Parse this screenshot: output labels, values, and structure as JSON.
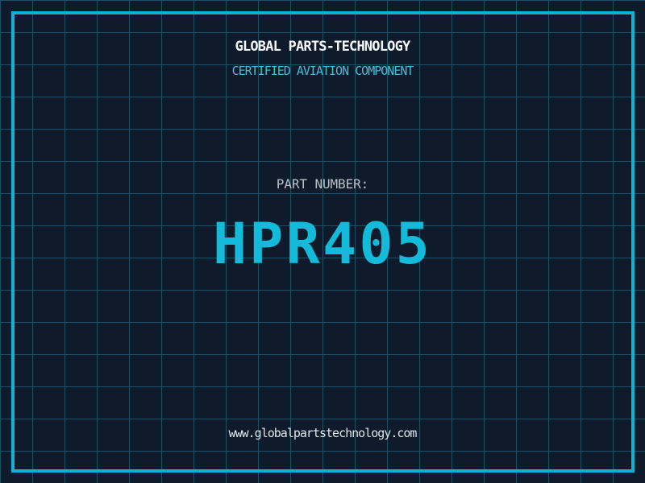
{
  "screen": {
    "company_title": "GLOBAL PARTS-TECHNOLOGY",
    "subtitle": "CERTIFIED AVIATION COMPONENT",
    "part_number_label": "PART NUMBER:",
    "part_number": "HPR405",
    "website": "www.globalpartstechnology.com"
  },
  "colors": {
    "background": "#0f1a2a",
    "grid_line": "#1d5064",
    "frame_border": "#0fb1d5",
    "title_text": "#f5f8fa",
    "subtitle_text": "#3ec0dc",
    "label_text": "#b9c2c9",
    "part_number_text": "#14bada",
    "website_text": "#dde6ea"
  }
}
